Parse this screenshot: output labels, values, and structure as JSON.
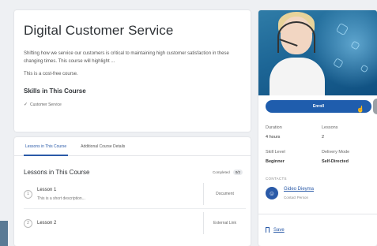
{
  "course": {
    "title": "Digital Customer Service",
    "description": "Shifting how we service our customers is critical to maintaining high customer satisfaction in these changing times. This course will highlight ...",
    "free_note": "This is a cost-free course.",
    "skills_heading": "Skills in This Course",
    "skills": [
      "Customer Service"
    ]
  },
  "tabs": [
    {
      "label": "Lessons in This Course",
      "active": true
    },
    {
      "label": "Additional Course Details",
      "active": false
    }
  ],
  "lessons": {
    "title": "Lessons in This Course",
    "completed_label": "Completed",
    "completed_count": "0/2",
    "items": [
      {
        "number": "1",
        "name": "Lesson 1",
        "description": "This is a short description...",
        "type": "Document"
      },
      {
        "number": "2",
        "name": "Lesson 2",
        "description": "",
        "type": "External Link"
      }
    ]
  },
  "side": {
    "enroll_label": "Enroll",
    "duration_label": "Duration",
    "duration_value": "4 hours",
    "lessons_label": "Lessons",
    "lessons_value": "2",
    "skill_level_label": "Skill Level",
    "skill_level_value": "Beginner",
    "delivery_mode_label": "Delivery Mode",
    "delivery_mode_value": "Self-Directed",
    "contacts_label": "CONTACTS",
    "contact_name": "Gideo Dieyma",
    "contact_role": "Contact Person",
    "save_label": "Save"
  },
  "icons": {
    "check": "check-icon",
    "avatar": "user-icon",
    "save": "bookmark-icon",
    "cursor": "hand-cursor-icon"
  },
  "colors": {
    "accent": "#1f5dad",
    "link": "#2a5aa8",
    "background": "#eef0f3"
  }
}
